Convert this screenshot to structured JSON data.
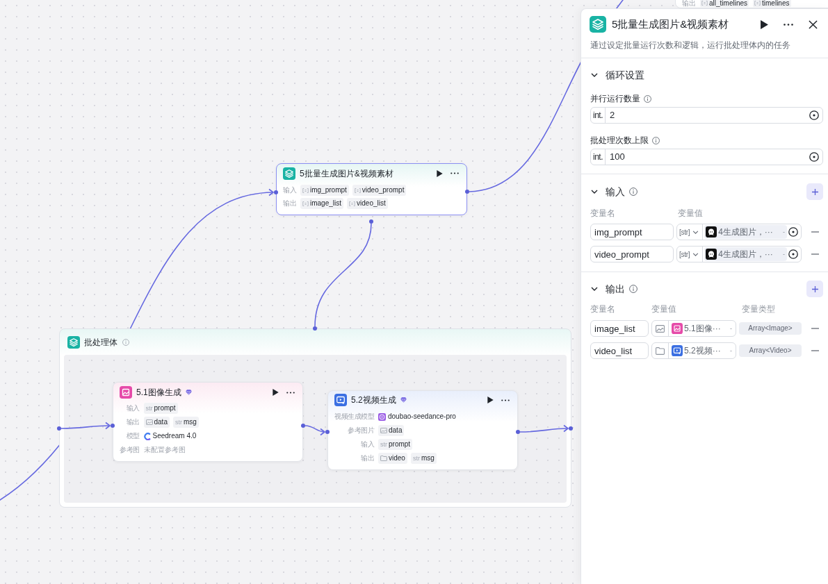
{
  "canvas": {
    "partial_node": {
      "rows": [
        {
          "kind": "chips",
          "label": "输出",
          "chips": [
            {
              "kind": "array",
              "name": "all_timelines"
            },
            {
              "kind": "array",
              "name": "timelines"
            }
          ]
        }
      ]
    },
    "nodes": [
      {
        "kind": "batch",
        "title": "5批量生成图片&视频素材",
        "selected": true,
        "rows": [
          {
            "kind": "chips",
            "label": "输入",
            "chips": [
              {
                "kind": "array",
                "name": "img_prompt"
              },
              {
                "kind": "array",
                "name": "video_prompt"
              }
            ]
          },
          {
            "kind": "chips",
            "label": "输出",
            "chips": [
              {
                "kind": "array",
                "name": "image_list"
              },
              {
                "kind": "array",
                "name": "video_list"
              }
            ]
          }
        ]
      }
    ],
    "batch_body": {
      "title": "批处理体",
      "nodes": [
        {
          "kind": "image",
          "title": "5.1图像生成",
          "selected": false,
          "rows": [
            {
              "kind": "chips",
              "label": "输入",
              "chips": [
                {
                  "kind": "text",
                  "type_label": "str",
                  "name": "prompt"
                }
              ]
            },
            {
              "kind": "chips",
              "label": "输出",
              "chips": [
                {
                  "kind": "image",
                  "name": "data"
                },
                {
                  "kind": "text",
                  "type_label": "str",
                  "name": "msg"
                }
              ]
            },
            {
              "kind": "model",
              "label": "模型",
              "value": "Seedream 4.0"
            },
            {
              "kind": "note",
              "label": "参考图",
              "value": "未配置参考图"
            }
          ]
        },
        {
          "kind": "video",
          "title": "5.2视频生成",
          "selected": false,
          "rows": [
            {
              "kind": "model",
              "label": "视频生成模型",
              "value": "doubao-seedance-pro"
            },
            {
              "kind": "chips",
              "label": "参考图片",
              "chips": [
                {
                  "kind": "image",
                  "name": "data"
                }
              ]
            },
            {
              "kind": "chips",
              "label": "输入",
              "chips": [
                {
                  "kind": "text",
                  "type_label": "str",
                  "name": "prompt"
                }
              ]
            },
            {
              "kind": "chips",
              "label": "输出",
              "chips": [
                {
                  "kind": "video",
                  "name": "video"
                },
                {
                  "kind": "text",
                  "type_label": "str",
                  "name": "msg"
                }
              ]
            }
          ]
        }
      ]
    }
  },
  "panel": {
    "title": "5批量生成图片&视频素材",
    "description": "通过设定批量运行次数和逻辑，运行批处理体内的任务",
    "sections": [
      {
        "kind": "settings",
        "title": "循环设置",
        "expanded": true,
        "fields": [
          {
            "label": "并行运行数量",
            "type_label": "int.",
            "value": "2"
          },
          {
            "label": "批处理次数上限",
            "type_label": "int.",
            "value": "100"
          }
        ]
      },
      {
        "kind": "inputs",
        "title": "输入",
        "expanded": true,
        "columns": [
          "变量名",
          "变量值"
        ],
        "rows": [
          {
            "name": "img_prompt",
            "type": {
              "kind": "text",
              "label": "[str]"
            },
            "source": {
              "kind": "custom",
              "label": "4生成图片，···",
              "suffix": "-"
            }
          },
          {
            "name": "video_prompt",
            "type": {
              "kind": "text",
              "label": "[str]"
            },
            "source": {
              "kind": "custom",
              "label": "4生成图片，···",
              "suffix": "-"
            }
          }
        ]
      },
      {
        "kind": "outputs",
        "title": "输出",
        "expanded": true,
        "columns": [
          "变量名",
          "变量值",
          "变量类型"
        ],
        "rows": [
          {
            "name": "image_list",
            "type": {
              "kind": "image"
            },
            "source": {
              "kind": "image",
              "label": "5.1图像···",
              "suffix": "-"
            },
            "var_type": "Array<Image>"
          },
          {
            "name": "video_list",
            "type": {
              "kind": "video"
            },
            "source": {
              "kind": "video",
              "label": "5.2视频···",
              "suffix": "-"
            },
            "var_type": "Array<Video>"
          }
        ]
      }
    ]
  }
}
